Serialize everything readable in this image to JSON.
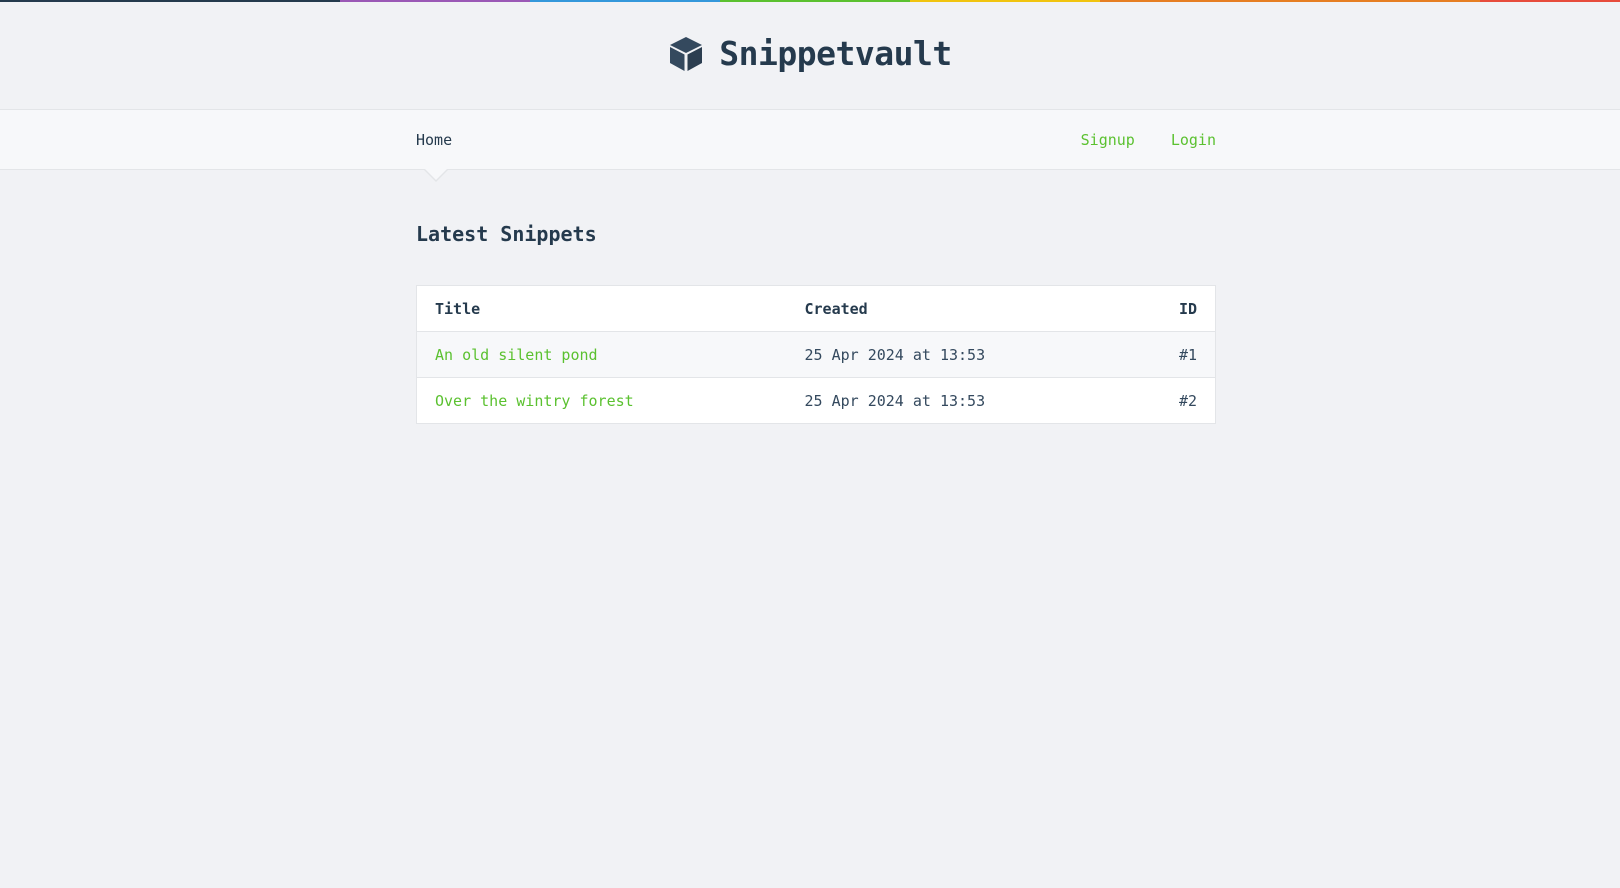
{
  "colors": {
    "accent": "#5bc130",
    "heading": "#253a4d",
    "background": "#f1f2f5",
    "rainbow": [
      "#253a4d",
      "#9b59b6",
      "#3498db",
      "#5bc130",
      "#f1c40f",
      "#e67e22",
      "#e74c3c"
    ]
  },
  "header": {
    "icon": "cube-icon",
    "brand": "Snippetvault"
  },
  "nav": {
    "home": "Home",
    "signup": "Signup",
    "login": "Login"
  },
  "page": {
    "title": "Latest Snippets"
  },
  "table": {
    "columns": [
      "Title",
      "Created",
      "ID"
    ],
    "rows": [
      {
        "title": "An old silent pond",
        "created": "25 Apr 2024 at 13:53",
        "id": "#1"
      },
      {
        "title": "Over the wintry forest",
        "created": "25 Apr 2024 at 13:53",
        "id": "#2"
      }
    ]
  }
}
